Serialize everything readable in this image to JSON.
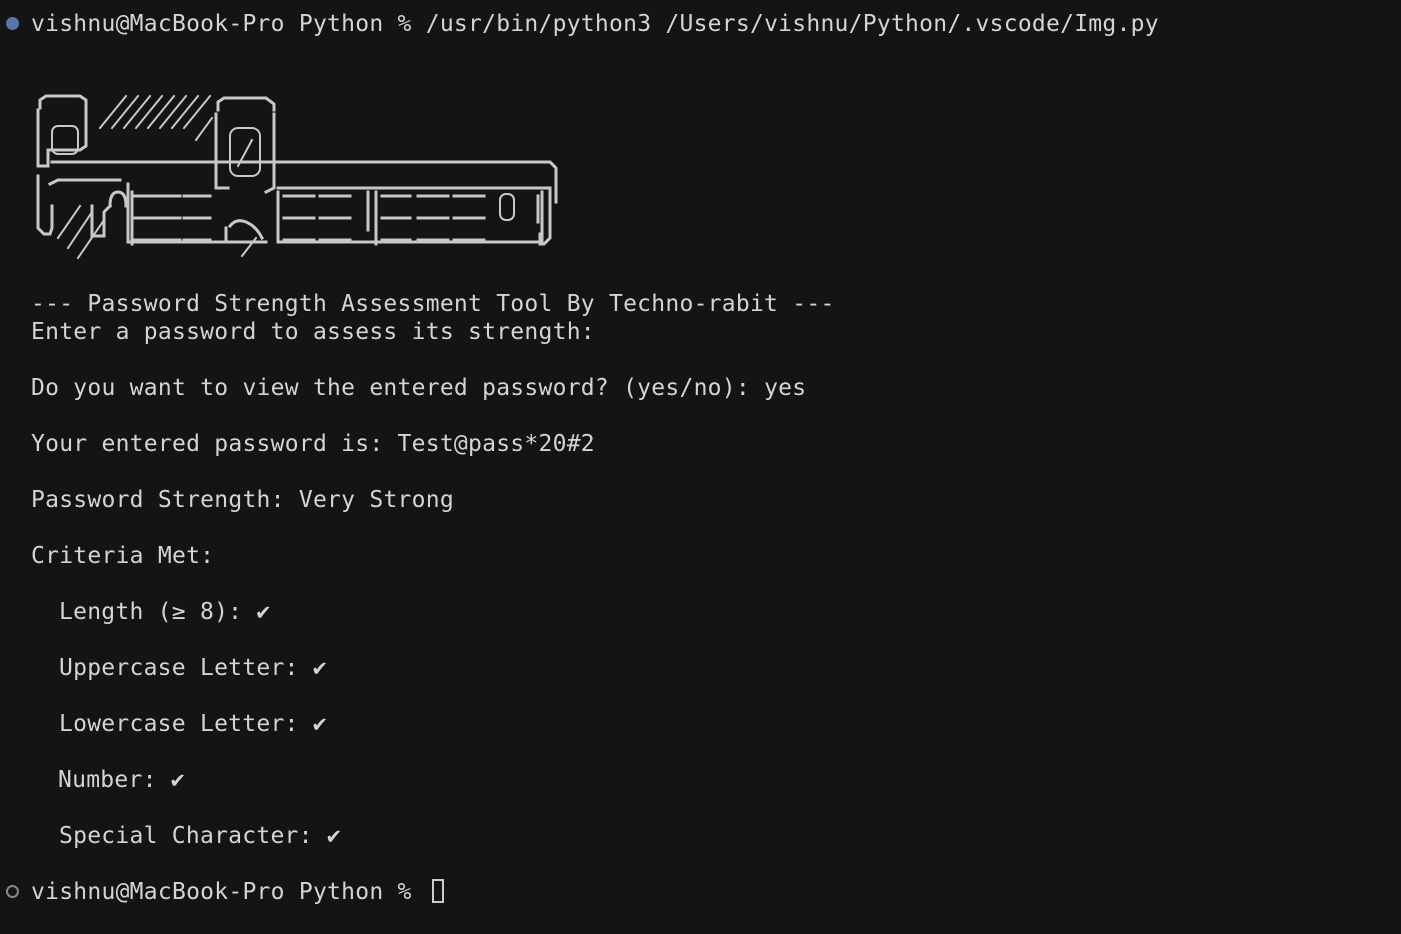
{
  "terminal": {
    "command_line": {
      "prompt": "vishnu@MacBook-Pro Python % ",
      "command": "/usr/bin/python3 /Users/vishnu/Python/.vscode/Img.py"
    },
    "output": {
      "tool_title": "--- Password Strength Assessment Tool By Techno-rabit ---",
      "enter_prompt": "Enter a password to assess its strength:",
      "view_question": "Do you want to view the entered password? (yes/no): ",
      "view_answer": "yes",
      "password_label": "Your entered password is: ",
      "password_value": "Test@pass*20#2",
      "strength_label": "Password Strength: ",
      "strength_value": "Very Strong",
      "criteria_heading": "Criteria Met:",
      "criteria": [
        {
          "label": "Length (≥ 8): ",
          "mark": "✔"
        },
        {
          "label": "Uppercase Letter: ",
          "mark": "✔"
        },
        {
          "label": "Lowercase Letter: ",
          "mark": "✔"
        },
        {
          "label": "Number: ",
          "mark": "✔"
        },
        {
          "label": "Special Character: ",
          "mark": "✔"
        }
      ]
    },
    "final_prompt": "vishnu@MacBook-Pro Python % ",
    "colors": {
      "background": "#141414",
      "text": "#d4d4d4",
      "status_dot_success": "#5a74a8",
      "status_dot_pending": "#8a8a8a"
    }
  }
}
